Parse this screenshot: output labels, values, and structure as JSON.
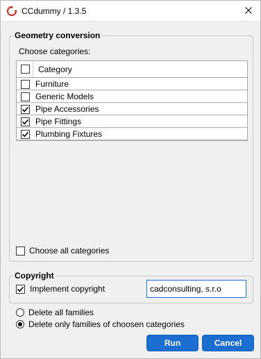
{
  "window": {
    "title": "CCdummy / 1.3.5",
    "icon": "app-logo-icon",
    "close_icon": "close-icon"
  },
  "geometry": {
    "legend": "Geometry conversion",
    "choose_label": "Choose categories:",
    "table_header": "Category",
    "header_checked": false,
    "categories": [
      {
        "label": "Furniture",
        "checked": false
      },
      {
        "label": "Generic Models",
        "checked": false
      },
      {
        "label": "Pipe Accessories",
        "checked": true
      },
      {
        "label": "Pipe Fittings",
        "checked": true
      },
      {
        "label": "Plumbing Fixtures",
        "checked": true
      }
    ],
    "choose_all_label": "Choose all categories",
    "choose_all_checked": false
  },
  "copyright": {
    "legend": "Copyright",
    "implement_label": "Implement copyright",
    "implement_checked": true,
    "value": "cadconsulting, s.r.o"
  },
  "delete_options": {
    "options": [
      {
        "label": "Delete all families",
        "selected": false
      },
      {
        "label": "Delete only families of choosen categories",
        "selected": true
      }
    ]
  },
  "buttons": {
    "run": "Run",
    "cancel": "Cancel"
  },
  "colors": {
    "accent": "#1c6fd1",
    "window_bg": "#f0f0f0"
  }
}
